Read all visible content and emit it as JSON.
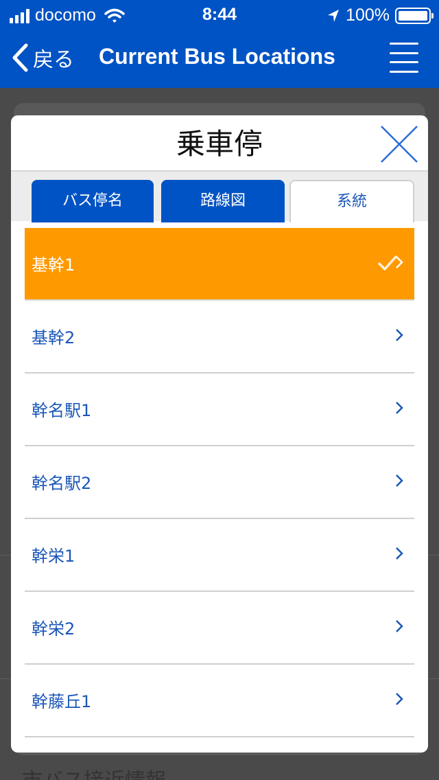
{
  "status_bar": {
    "carrier": "docomo",
    "time": "8:44",
    "battery": "100%"
  },
  "nav": {
    "back_label": "戻る",
    "title": "Current Bus Locations"
  },
  "background": {
    "partial_text": "市バス接近情報"
  },
  "modal": {
    "title": "乗車停",
    "tabs": [
      {
        "label": "バス停名"
      },
      {
        "label": "路線図"
      },
      {
        "label": "系統"
      }
    ],
    "items": [
      {
        "label": "基幹1"
      },
      {
        "label": "基幹2"
      },
      {
        "label": "幹名駅1"
      },
      {
        "label": "幹名駅2"
      },
      {
        "label": "幹栄1"
      },
      {
        "label": "幹栄2"
      },
      {
        "label": "幹藤丘1"
      }
    ]
  },
  "colors": {
    "header_blue": "#0053c4",
    "selected_orange": "#ff9900",
    "link_blue": "#1a56b8"
  }
}
